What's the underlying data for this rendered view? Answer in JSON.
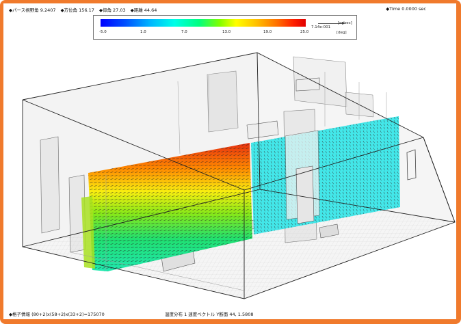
{
  "header": {
    "pers_fov": "◆パース視野角  9.2407",
    "azimuth": "◆方位角 156.17",
    "elevation": "◆仰角 27.03",
    "distance": "◆距離 44.64",
    "time": "◆Time 0.0000    sec"
  },
  "legend": {
    "ticks": [
      "-5.0",
      "1.0",
      "7.0",
      "13.0",
      "19.0",
      "25.0"
    ],
    "unit_temp": "[deg]",
    "vector_value": "7.14e-001",
    "unit_velocity": "[m/sec]",
    "colors": [
      "#0000ff",
      "#00b4ff",
      "#00ffe8",
      "#00ff80",
      "#ffff00",
      "#ff7000",
      "#e00000"
    ]
  },
  "footer": {
    "mesh_info": "◆格子情報  (80+2)x(58+2)x(33+2)=175070",
    "display_info": "温度分布 1 速度ベクトル Y断面  44,  1.5808"
  },
  "frame_color": "#f07a2c"
}
